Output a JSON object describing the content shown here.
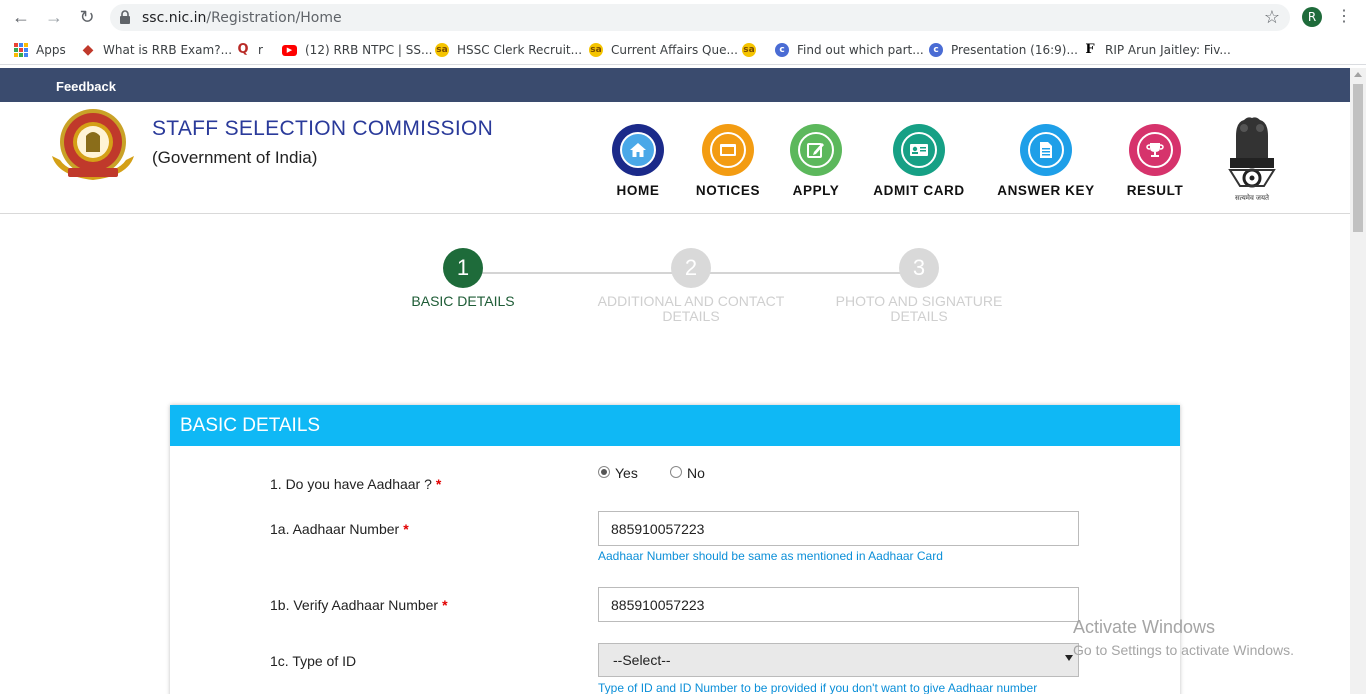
{
  "browser": {
    "url_host": "ssc.nic.in",
    "url_path": "/Registration/Home",
    "avatar_letter": "R",
    "bookmarks": [
      {
        "label": "Apps",
        "icon": "apps-grid-icon"
      },
      {
        "label": "What is RRB Exam?...",
        "icon": "diamond-icon",
        "color": "#c0392b"
      },
      {
        "label": "r",
        "icon": "quora-icon",
        "color": "#b92b27",
        "glyph": "Q"
      },
      {
        "label": "(12) RRB NTPC | SS...",
        "icon": "youtube-icon",
        "color": "#ff0000",
        "glyph": "▶"
      },
      {
        "label": "HSSC Clerk Recruit...",
        "icon": "sa-icon",
        "color": "#f5c400",
        "glyph": "sa"
      },
      {
        "label": "Current Affairs Que...",
        "icon": "sa-icon",
        "color": "#f5c400",
        "glyph": "sa"
      },
      {
        "label": "",
        "icon": "sa-icon",
        "color": "#f5c400",
        "glyph": "sa"
      },
      {
        "label": "Find out which part...",
        "icon": "c-icon",
        "color": "#4a6cd4",
        "glyph": "c"
      },
      {
        "label": "Presentation (16:9)...",
        "icon": "c-icon",
        "color": "#4a6cd4",
        "glyph": "c"
      },
      {
        "label": "RIP Arun Jaitley: Fiv...",
        "icon": "f-icon",
        "color": "#000000",
        "glyph": "F"
      }
    ]
  },
  "topbar": {
    "feedback": "Feedback"
  },
  "header": {
    "title": "STAFF SELECTION COMMISSION",
    "subtitle": "(Government of India)",
    "nav": [
      {
        "label": "HOME",
        "icon": "home-icon",
        "ring": "#1b2a8a",
        "fill": "#4aa8e8"
      },
      {
        "label": "NOTICES",
        "icon": "notices-icon",
        "ring": "#f39c12",
        "fill": "#f39c12"
      },
      {
        "label": "APPLY",
        "icon": "apply-icon",
        "ring": "#5cb85c",
        "fill": "#5cb85c"
      },
      {
        "label": "ADMIT CARD",
        "icon": "admit-card-icon",
        "ring": "#16a085",
        "fill": "#16a085"
      },
      {
        "label": "ANSWER KEY",
        "icon": "answer-key-icon",
        "ring": "#1e9fe8",
        "fill": "#1e9fe8"
      },
      {
        "label": "RESULT",
        "icon": "result-icon",
        "ring": "#d6336c",
        "fill": "#d6336c"
      }
    ],
    "emblem_caption": "सत्यमेव जयते"
  },
  "stepper": {
    "steps": [
      {
        "number": "1",
        "label_line1": "BASIC DETAILS",
        "label_line2": "",
        "active": true
      },
      {
        "number": "2",
        "label_line1": "ADDITIONAL AND CONTACT",
        "label_line2": "DETAILS",
        "active": false
      },
      {
        "number": "3",
        "label_line1": "PHOTO AND SIGNATURE",
        "label_line2": "DETAILS",
        "active": false
      }
    ],
    "active_color": "#1e6b3a",
    "inactive_color": "#d9d9d9"
  },
  "form": {
    "title": "BASIC DETAILS",
    "q1": {
      "label": "1. Do you have Aadhaar ?",
      "required": "*",
      "options": [
        "Yes",
        "No"
      ],
      "selected": "Yes"
    },
    "q1a": {
      "label": "1a. Aadhaar Number",
      "required": "*",
      "value": "885910057223",
      "hint": "Aadhaar Number should be same as mentioned in Aadhaar Card"
    },
    "q1b": {
      "label": "1b. Verify Aadhaar Number",
      "required": "*",
      "value": "885910057223"
    },
    "q1c": {
      "label": "1c. Type of ID",
      "selected": "--Select--",
      "hint": "Type of ID and ID Number to be provided if you don't want to give Aadhaar number"
    }
  },
  "watermark": {
    "line1": "Activate Windows",
    "line2": "Go to Settings to activate Windows."
  }
}
